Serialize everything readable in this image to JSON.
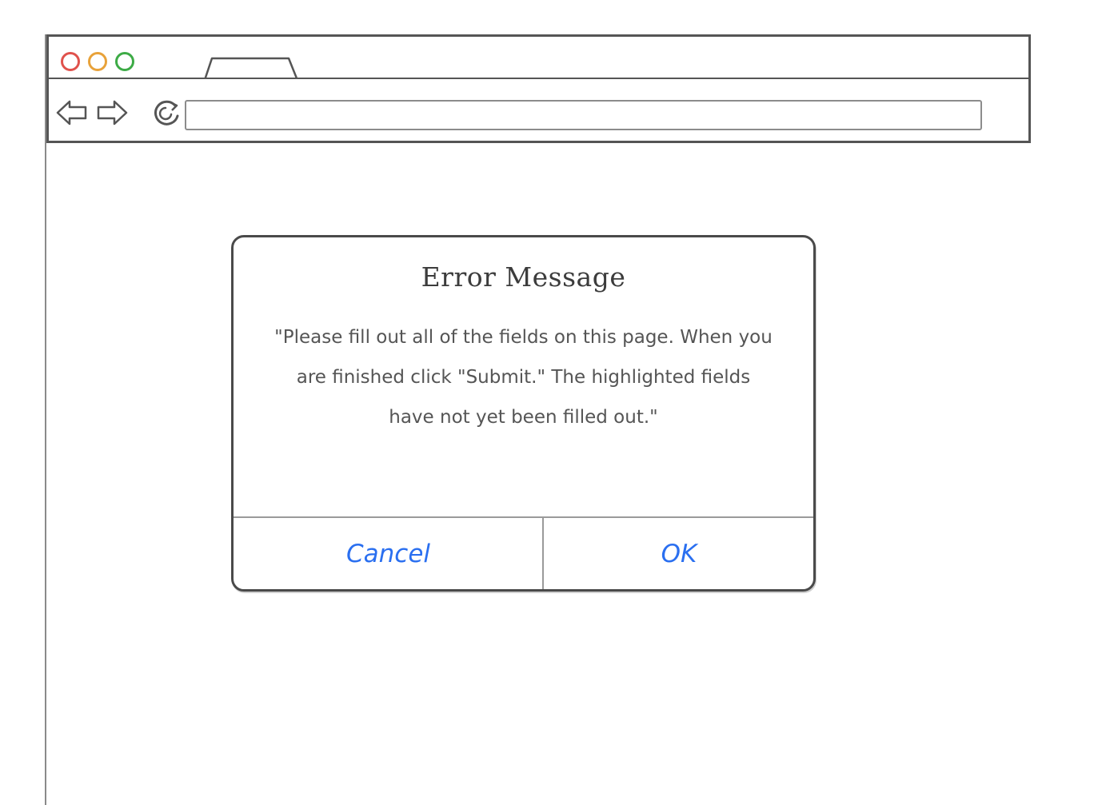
{
  "browser": {
    "address_bar": {
      "value": "",
      "placeholder": ""
    },
    "icons": {
      "back": "back-arrow-icon",
      "forward": "forward-arrow-icon",
      "reload": "reload-icon"
    },
    "window_controls": {
      "close_color": "#e0524c",
      "minimize_color": "#e8a23a",
      "maximize_color": "#3dab46"
    }
  },
  "dialog": {
    "title": "Error Message",
    "message": "\"Please fill out all of the fields on this page. When you are finished click \"Submit.\" The highlighted fields have not yet been filled out.\"",
    "buttons": {
      "cancel_label": "Cancel",
      "ok_label": "OK"
    },
    "button_color": "#2a6ff0"
  }
}
